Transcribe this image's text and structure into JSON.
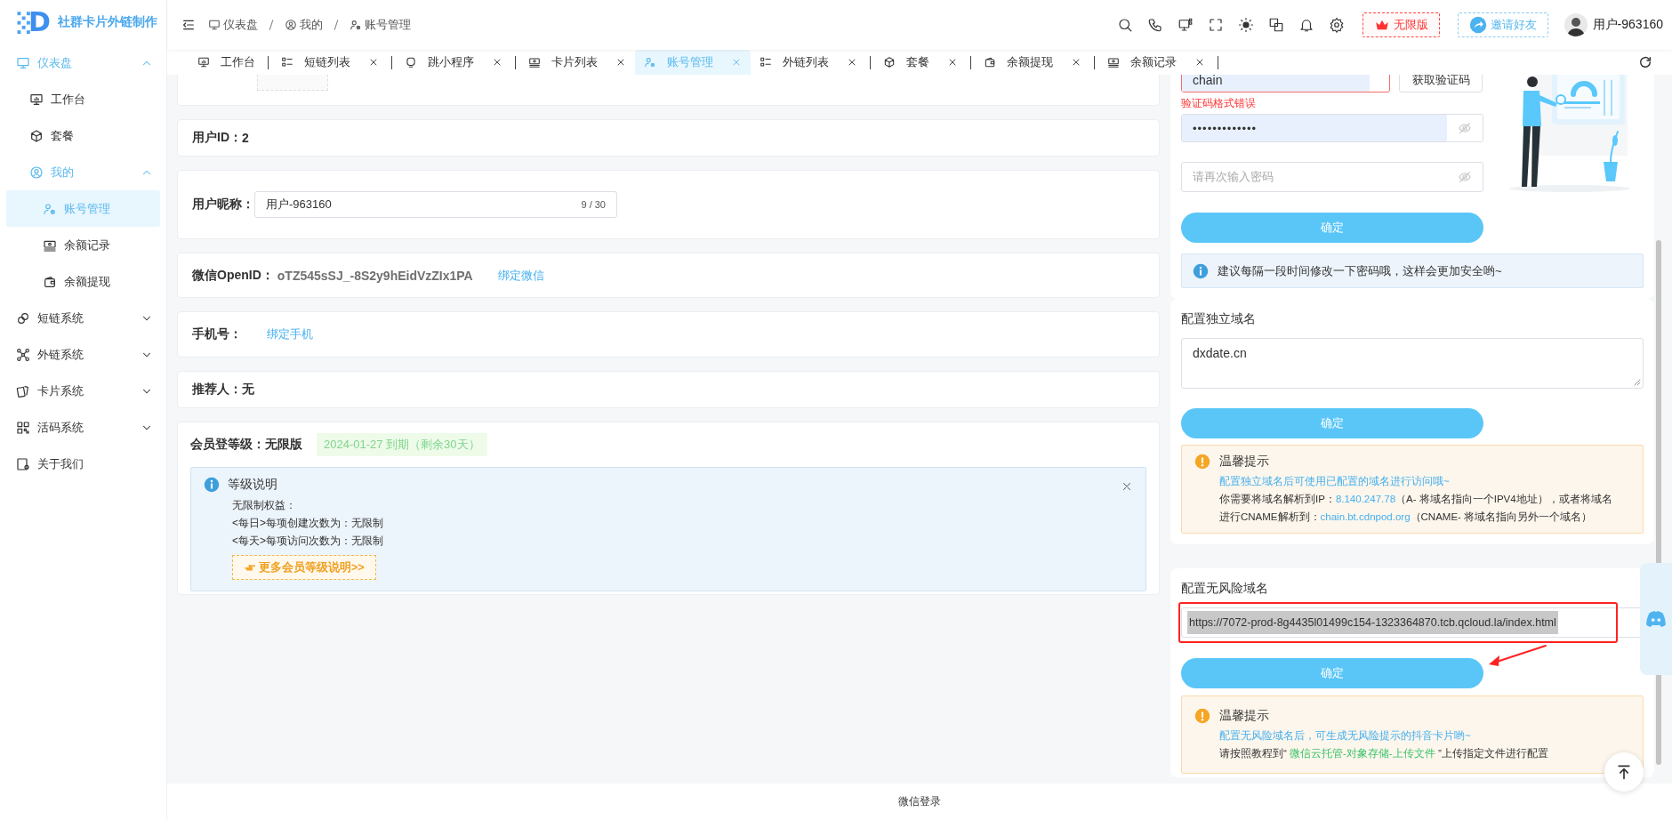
{
  "brand": {
    "logo_letter": "D",
    "name": "社群卡片外链制作"
  },
  "sidebar": {
    "items": [
      {
        "label": "仪表盘",
        "expanded": true,
        "selected": false,
        "children": [
          {
            "label": "工作台",
            "selected": false
          },
          {
            "label": "套餐",
            "selected": false
          },
          {
            "label": "我的",
            "expanded": true,
            "selected": false,
            "children": [
              {
                "label": "账号管理",
                "selected": true
              },
              {
                "label": "余额记录",
                "selected": false
              },
              {
                "label": "余额提现",
                "selected": false
              }
            ]
          }
        ]
      },
      {
        "label": "短链系统",
        "expanded": false,
        "selected": false
      },
      {
        "label": "外链系统",
        "expanded": false,
        "selected": false
      },
      {
        "label": "卡片系统",
        "expanded": false,
        "selected": false
      },
      {
        "label": "活码系统",
        "expanded": false,
        "selected": false
      },
      {
        "label": "关于我们",
        "selected": false
      }
    ]
  },
  "breadcrumb": [
    "仪表盘",
    "我的",
    "账号管理"
  ],
  "header": {
    "plan_button": "无限版",
    "invite_button": "邀请好友",
    "user_name": "用户-963160"
  },
  "tabs": [
    {
      "label": "工作台",
      "closable": false,
      "selected": false
    },
    {
      "label": "短链列表",
      "closable": true,
      "selected": false
    },
    {
      "label": "跳小程序",
      "closable": true,
      "selected": false
    },
    {
      "label": "卡片列表",
      "closable": true,
      "selected": false
    },
    {
      "label": "账号管理",
      "closable": true,
      "selected": true
    },
    {
      "label": "外链列表",
      "closable": true,
      "selected": false
    },
    {
      "label": "套餐",
      "closable": true,
      "selected": false
    },
    {
      "label": "余额提现",
      "closable": true,
      "selected": false
    },
    {
      "label": "余额记录",
      "closable": true,
      "selected": false
    }
  ],
  "profile": {
    "cards": [
      {
        "kind": "avatar"
      },
      {
        "kind": "text",
        "label": "用户ID：",
        "value": "2"
      },
      {
        "kind": "input",
        "label": "用户昵称：",
        "value": "用户-963160",
        "counter": "9 / 30"
      },
      {
        "kind": "link",
        "label": "微信OpenID：",
        "value": "oTZ545sSJ_-8S2y9hEidVzZIx1PA",
        "link": "绑定微信"
      },
      {
        "kind": "link",
        "label": "手机号：",
        "link": "绑定手机"
      },
      {
        "kind": "text",
        "label": "推荐人：",
        "value": "无"
      },
      {
        "kind": "level",
        "label": "会员登等级：",
        "value": "无限版",
        "expiry": "2024-01-27 到期（剩余30天）",
        "notice": {
          "title": "等级说明",
          "lines": [
            "无限制权益：",
            "<每日>每项创建次数为：无限制",
            "<每天>每项访问次数为：无限制"
          ],
          "button": "更多会员等级说明>>"
        }
      }
    ]
  },
  "password_card": {
    "code_value": "chain",
    "code_invalid": true,
    "code_button": "获取验证码",
    "code_error": "验证码格式错误",
    "password_value": "•••••••••••••",
    "confirm_placeholder": "请再次输入密码",
    "submit": "确定",
    "tip": "建议每隔一段时间修改一下密码哦，这样会更加安全哟~"
  },
  "domain_card": {
    "title": "配置独立域名",
    "value": "dxdate.cn",
    "submit": "确定",
    "notice": {
      "title": "温馨提示",
      "lines": [
        [
          {
            "text": "配置独立域名后可使用已配置的域名进行访问哦~",
            "kind": "link"
          }
        ],
        [
          {
            "text": "你需要将域名解析到IP：",
            "kind": "plain"
          },
          {
            "text": "8.140.247.78",
            "kind": "link"
          },
          {
            "text": "（A- 将域名指向一个IPV4地址），或者将域名",
            "kind": "plain"
          }
        ],
        [
          {
            "text": "进行CNAME解析到：",
            "kind": "plain"
          },
          {
            "text": "chain.bt.cdnpod.org",
            "kind": "link"
          },
          {
            "text": "（CNAME- 将域名指向另外一个域名）",
            "kind": "plain"
          }
        ]
      ]
    }
  },
  "safe_domain_card": {
    "title": "配置无风险域名",
    "value": "https://7072-prod-8g4435l01499c154-1323364870.tcb.qcloud.la/index.html",
    "text_selected": true,
    "highlighted": true,
    "pointer_arrow": true,
    "submit": "确定",
    "notice": {
      "title": "温馨提示",
      "lines": [
        [
          {
            "text": "配置无风险域名后，可生成无风险提示的抖音卡片哟~",
            "kind": "link"
          }
        ],
        [
          {
            "text": "请按照教程到“",
            "kind": "plain"
          },
          {
            "text": " 微信云托管-对象存储-上传文件 ",
            "kind": "accent"
          },
          {
            "text": "”上传指定文件进行配置",
            "kind": "plain"
          }
        ]
      ]
    }
  },
  "footer": {
    "text": "微信登录"
  }
}
